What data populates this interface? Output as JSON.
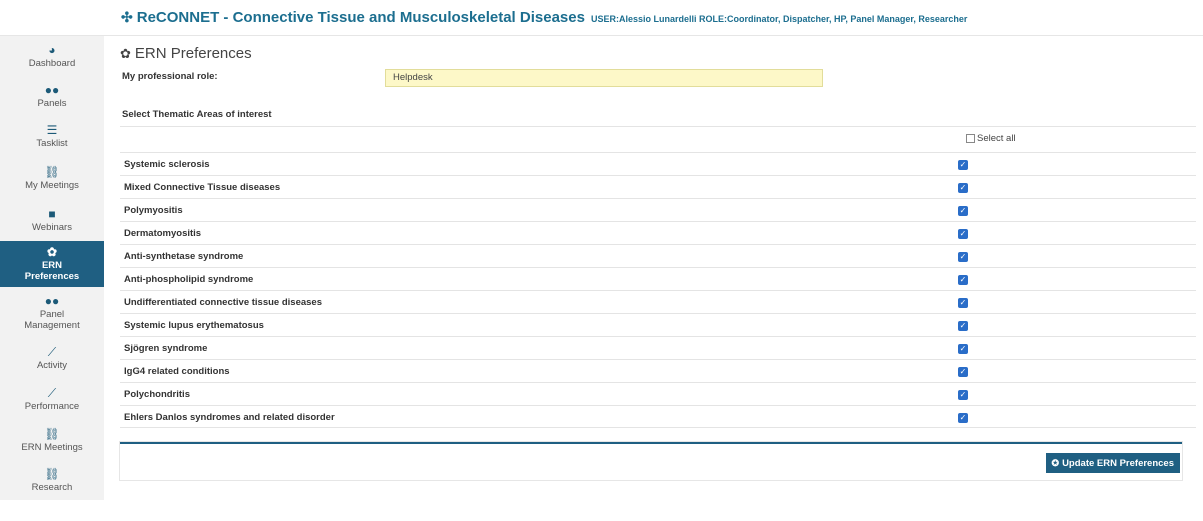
{
  "header": {
    "title": "ReCONNET - Connective Tissue and Musculoskeletal Diseases",
    "user_info": "USER:Alessio Lunardelli ROLE:Coordinator, Dispatcher, HP, Panel Manager, Researcher"
  },
  "sidebar": {
    "items": [
      {
        "label": "Dashboard",
        "icon": "dashboard-icon",
        "glyph": "◕"
      },
      {
        "label": "Panels",
        "icon": "group-icon",
        "glyph": "👥"
      },
      {
        "label": "Tasklist",
        "icon": "list-icon",
        "glyph": "☰"
      },
      {
        "label": "My Meetings",
        "icon": "meeting-icon",
        "glyph": "⛓"
      },
      {
        "label": "Webinars",
        "icon": "video-icon",
        "glyph": "■"
      },
      {
        "label": "ERN\nPreferences",
        "icon": "gear-icon",
        "glyph": "✿"
      },
      {
        "label": "Panel\nManagement",
        "icon": "group-icon",
        "glyph": "👥"
      },
      {
        "label": "Activity",
        "icon": "chart-icon",
        "glyph": "📈"
      },
      {
        "label": "Performance",
        "icon": "chart-icon",
        "glyph": "📈"
      },
      {
        "label": "ERN Meetings",
        "icon": "meeting-icon",
        "glyph": "⛓"
      },
      {
        "label": "Research",
        "icon": "meeting-icon",
        "glyph": "⛓"
      }
    ]
  },
  "main": {
    "page_title": "ERN Preferences",
    "role_label": "My professional role:",
    "role_value": "Helpdesk",
    "areas_heading": "Select Thematic Areas of interest",
    "select_all_label": "Select all",
    "areas": [
      "Systemic sclerosis",
      "Mixed Connective Tissue diseases",
      "Polymyositis",
      "Dermatomyositis",
      "Anti-synthetase syndrome",
      "Anti-phospholipid syndrome",
      "Undifferentiated connective tissue diseases",
      "Systemic lupus erythematosus",
      "Sjögren syndrome",
      "IgG4 related conditions",
      "Polychondritis",
      "Ehlers Danlos syndromes and related disorder"
    ],
    "update_button": "Update ERN Preferences"
  }
}
